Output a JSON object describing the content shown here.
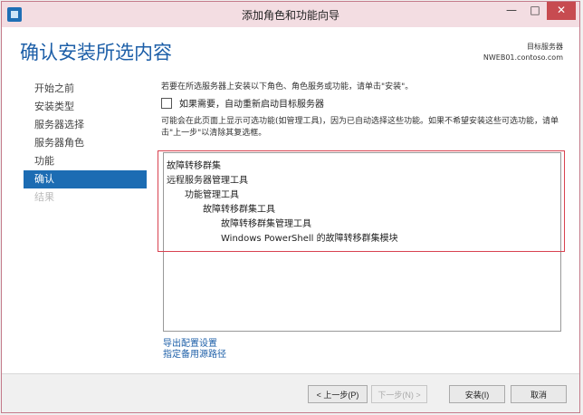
{
  "window": {
    "title": "添加角色和功能向导"
  },
  "header": {
    "page_title": "确认安装所选内容",
    "target_server_label": "目标服务器",
    "target_server_value": "NWEB01.contoso.com"
  },
  "nav": [
    {
      "label": "开始之前"
    },
    {
      "label": "安装类型"
    },
    {
      "label": "服务器选择"
    },
    {
      "label": "服务器角色"
    },
    {
      "label": "功能"
    },
    {
      "label": "确认"
    },
    {
      "label": "结果"
    }
  ],
  "content": {
    "intro": "若要在所选服务器上安装以下角色、角色服务或功能，请单击\"安装\"。",
    "restart_label": "如果需要，自动重新启动目标服务器",
    "note": "可能会在此页面上显示可选功能(如管理工具)，因为已自动选择这些功能。如果不希望安装这些可选功能，请单击\"上一步\"以清除其复选框。",
    "features": [
      {
        "label": "故障转移群集"
      },
      {
        "label": "远程服务器管理工具"
      },
      {
        "label": "功能管理工具"
      },
      {
        "label": "故障转移群集工具"
      },
      {
        "label": "故障转移群集管理工具"
      },
      {
        "label": "Windows PowerShell 的故障转移群集模块"
      }
    ],
    "links": {
      "export": "导出配置设置",
      "alternate": "指定备用源路径"
    }
  },
  "footer": {
    "prev": "< 上一步(P)",
    "next": "下一步(N) >",
    "install": "安装(I)",
    "cancel": "取消"
  }
}
